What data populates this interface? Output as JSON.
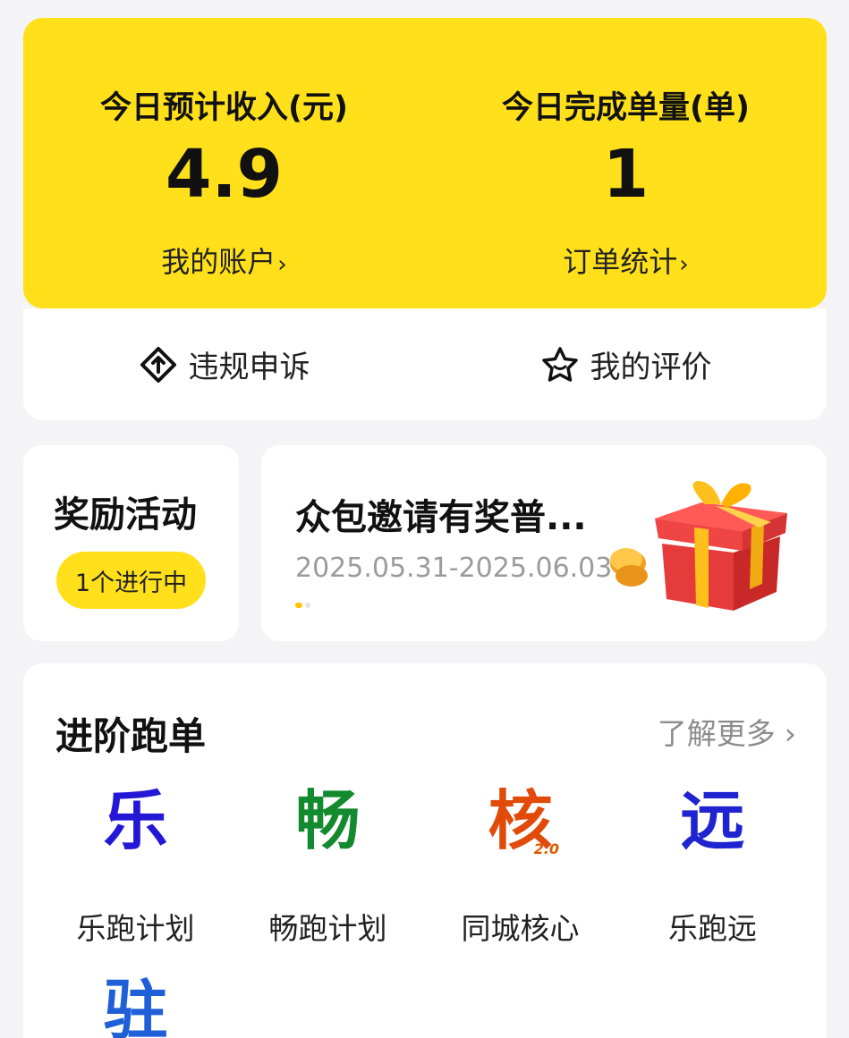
{
  "stats": {
    "income_title": "今日预计收入(元)",
    "income_value": "4.9",
    "account_link": "我的账户",
    "orders_title": "今日完成单量(单)",
    "orders_value": "1",
    "stats_link": "订单统计",
    "chevron": "›"
  },
  "actions": {
    "appeal_label": "违规申诉",
    "appeal_icon": "diamond-arrow-icon",
    "rating_label": "我的评价",
    "rating_icon": "star-face-icon"
  },
  "rewards": {
    "title": "奖励活动",
    "badge": "1个进行中"
  },
  "promo": {
    "title": "众包邀请有奖普...",
    "date": "2025.05.31-2025.06.03",
    "image": "gift-box-icon"
  },
  "advanced": {
    "title": "进阶跑单",
    "more": "了解更多",
    "more_chevron": "›",
    "plans": [
      {
        "glyph": "乐",
        "color": "#2418d6",
        "label": "乐跑计划"
      },
      {
        "glyph": "畅",
        "color": "#138a2e",
        "label": "畅跑计划"
      },
      {
        "glyph": "核",
        "color": "#e24a0a",
        "label": "同城核心",
        "sub": "2.0"
      },
      {
        "glyph": "远",
        "color": "#1f24d0",
        "label": "乐跑远"
      },
      {
        "glyph": "驻",
        "color": "#1f5fd8",
        "label": ""
      }
    ]
  },
  "colors": {
    "accent_yellow": "#ffe01a",
    "background": "#f4f4f6"
  }
}
